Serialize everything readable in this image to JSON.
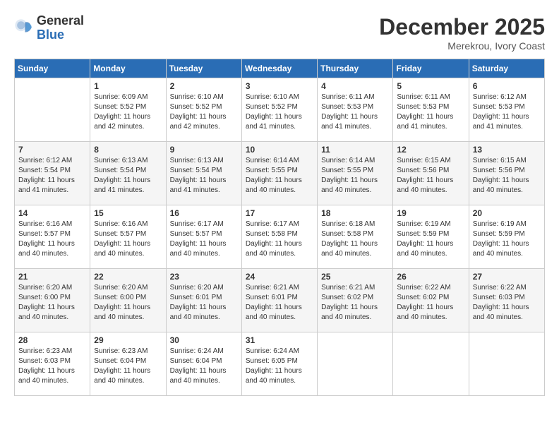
{
  "header": {
    "logo_general": "General",
    "logo_blue": "Blue",
    "month_title": "December 2025",
    "location": "Merekrou, Ivory Coast"
  },
  "days_of_week": [
    "Sunday",
    "Monday",
    "Tuesday",
    "Wednesday",
    "Thursday",
    "Friday",
    "Saturday"
  ],
  "weeks": [
    [
      {
        "day": "",
        "sunrise": "",
        "sunset": "",
        "daylight": ""
      },
      {
        "day": "1",
        "sunrise": "Sunrise: 6:09 AM",
        "sunset": "Sunset: 5:52 PM",
        "daylight": "Daylight: 11 hours and 42 minutes."
      },
      {
        "day": "2",
        "sunrise": "Sunrise: 6:10 AM",
        "sunset": "Sunset: 5:52 PM",
        "daylight": "Daylight: 11 hours and 42 minutes."
      },
      {
        "day": "3",
        "sunrise": "Sunrise: 6:10 AM",
        "sunset": "Sunset: 5:52 PM",
        "daylight": "Daylight: 11 hours and 41 minutes."
      },
      {
        "day": "4",
        "sunrise": "Sunrise: 6:11 AM",
        "sunset": "Sunset: 5:53 PM",
        "daylight": "Daylight: 11 hours and 41 minutes."
      },
      {
        "day": "5",
        "sunrise": "Sunrise: 6:11 AM",
        "sunset": "Sunset: 5:53 PM",
        "daylight": "Daylight: 11 hours and 41 minutes."
      },
      {
        "day": "6",
        "sunrise": "Sunrise: 6:12 AM",
        "sunset": "Sunset: 5:53 PM",
        "daylight": "Daylight: 11 hours and 41 minutes."
      }
    ],
    [
      {
        "day": "7",
        "sunrise": "Sunrise: 6:12 AM",
        "sunset": "Sunset: 5:54 PM",
        "daylight": "Daylight: 11 hours and 41 minutes."
      },
      {
        "day": "8",
        "sunrise": "Sunrise: 6:13 AM",
        "sunset": "Sunset: 5:54 PM",
        "daylight": "Daylight: 11 hours and 41 minutes."
      },
      {
        "day": "9",
        "sunrise": "Sunrise: 6:13 AM",
        "sunset": "Sunset: 5:54 PM",
        "daylight": "Daylight: 11 hours and 41 minutes."
      },
      {
        "day": "10",
        "sunrise": "Sunrise: 6:14 AM",
        "sunset": "Sunset: 5:55 PM",
        "daylight": "Daylight: 11 hours and 40 minutes."
      },
      {
        "day": "11",
        "sunrise": "Sunrise: 6:14 AM",
        "sunset": "Sunset: 5:55 PM",
        "daylight": "Daylight: 11 hours and 40 minutes."
      },
      {
        "day": "12",
        "sunrise": "Sunrise: 6:15 AM",
        "sunset": "Sunset: 5:56 PM",
        "daylight": "Daylight: 11 hours and 40 minutes."
      },
      {
        "day": "13",
        "sunrise": "Sunrise: 6:15 AM",
        "sunset": "Sunset: 5:56 PM",
        "daylight": "Daylight: 11 hours and 40 minutes."
      }
    ],
    [
      {
        "day": "14",
        "sunrise": "Sunrise: 6:16 AM",
        "sunset": "Sunset: 5:57 PM",
        "daylight": "Daylight: 11 hours and 40 minutes."
      },
      {
        "day": "15",
        "sunrise": "Sunrise: 6:16 AM",
        "sunset": "Sunset: 5:57 PM",
        "daylight": "Daylight: 11 hours and 40 minutes."
      },
      {
        "day": "16",
        "sunrise": "Sunrise: 6:17 AM",
        "sunset": "Sunset: 5:57 PM",
        "daylight": "Daylight: 11 hours and 40 minutes."
      },
      {
        "day": "17",
        "sunrise": "Sunrise: 6:17 AM",
        "sunset": "Sunset: 5:58 PM",
        "daylight": "Daylight: 11 hours and 40 minutes."
      },
      {
        "day": "18",
        "sunrise": "Sunrise: 6:18 AM",
        "sunset": "Sunset: 5:58 PM",
        "daylight": "Daylight: 11 hours and 40 minutes."
      },
      {
        "day": "19",
        "sunrise": "Sunrise: 6:19 AM",
        "sunset": "Sunset: 5:59 PM",
        "daylight": "Daylight: 11 hours and 40 minutes."
      },
      {
        "day": "20",
        "sunrise": "Sunrise: 6:19 AM",
        "sunset": "Sunset: 5:59 PM",
        "daylight": "Daylight: 11 hours and 40 minutes."
      }
    ],
    [
      {
        "day": "21",
        "sunrise": "Sunrise: 6:20 AM",
        "sunset": "Sunset: 6:00 PM",
        "daylight": "Daylight: 11 hours and 40 minutes."
      },
      {
        "day": "22",
        "sunrise": "Sunrise: 6:20 AM",
        "sunset": "Sunset: 6:00 PM",
        "daylight": "Daylight: 11 hours and 40 minutes."
      },
      {
        "day": "23",
        "sunrise": "Sunrise: 6:20 AM",
        "sunset": "Sunset: 6:01 PM",
        "daylight": "Daylight: 11 hours and 40 minutes."
      },
      {
        "day": "24",
        "sunrise": "Sunrise: 6:21 AM",
        "sunset": "Sunset: 6:01 PM",
        "daylight": "Daylight: 11 hours and 40 minutes."
      },
      {
        "day": "25",
        "sunrise": "Sunrise: 6:21 AM",
        "sunset": "Sunset: 6:02 PM",
        "daylight": "Daylight: 11 hours and 40 minutes."
      },
      {
        "day": "26",
        "sunrise": "Sunrise: 6:22 AM",
        "sunset": "Sunset: 6:02 PM",
        "daylight": "Daylight: 11 hours and 40 minutes."
      },
      {
        "day": "27",
        "sunrise": "Sunrise: 6:22 AM",
        "sunset": "Sunset: 6:03 PM",
        "daylight": "Daylight: 11 hours and 40 minutes."
      }
    ],
    [
      {
        "day": "28",
        "sunrise": "Sunrise: 6:23 AM",
        "sunset": "Sunset: 6:03 PM",
        "daylight": "Daylight: 11 hours and 40 minutes."
      },
      {
        "day": "29",
        "sunrise": "Sunrise: 6:23 AM",
        "sunset": "Sunset: 6:04 PM",
        "daylight": "Daylight: 11 hours and 40 minutes."
      },
      {
        "day": "30",
        "sunrise": "Sunrise: 6:24 AM",
        "sunset": "Sunset: 6:04 PM",
        "daylight": "Daylight: 11 hours and 40 minutes."
      },
      {
        "day": "31",
        "sunrise": "Sunrise: 6:24 AM",
        "sunset": "Sunset: 6:05 PM",
        "daylight": "Daylight: 11 hours and 40 minutes."
      },
      {
        "day": "",
        "sunrise": "",
        "sunset": "",
        "daylight": ""
      },
      {
        "day": "",
        "sunrise": "",
        "sunset": "",
        "daylight": ""
      },
      {
        "day": "",
        "sunrise": "",
        "sunset": "",
        "daylight": ""
      }
    ]
  ]
}
